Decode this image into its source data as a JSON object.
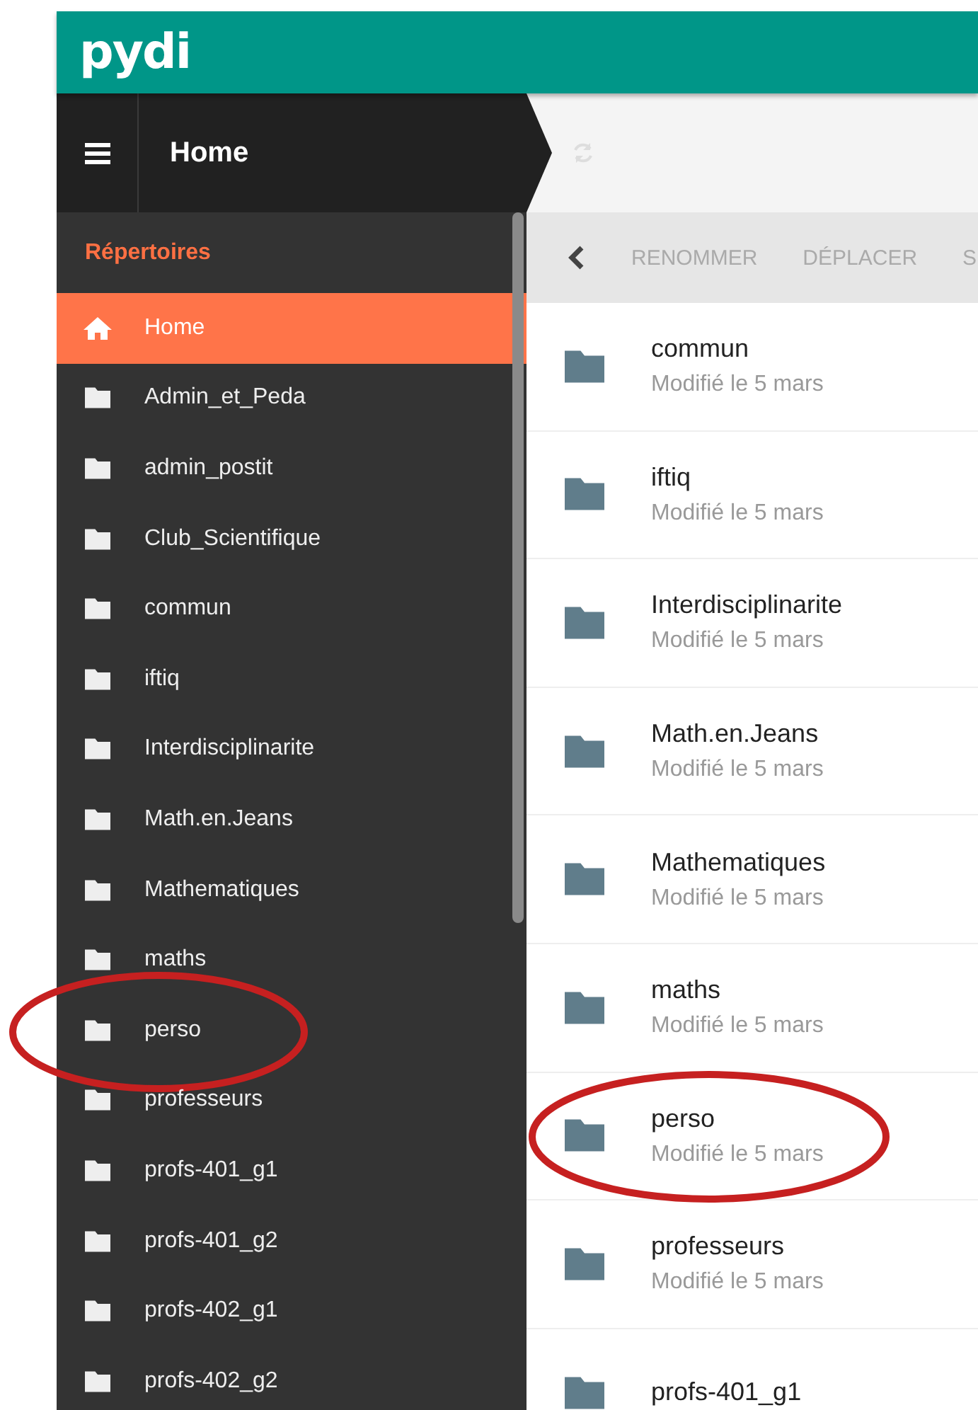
{
  "header": {
    "logo": "pydi",
    "title": "Home"
  },
  "sidebar": {
    "heading": "Répertoires",
    "items": [
      {
        "label": "Home",
        "kind": "home",
        "selected": true,
        "circled": false
      },
      {
        "label": "Admin_et_Peda",
        "kind": "folder",
        "selected": false,
        "circled": false
      },
      {
        "label": "admin_postit",
        "kind": "folder",
        "selected": false,
        "circled": false
      },
      {
        "label": "Club_Scientifique",
        "kind": "folder",
        "selected": false,
        "circled": false
      },
      {
        "label": "commun",
        "kind": "folder",
        "selected": false,
        "circled": false
      },
      {
        "label": "iftiq",
        "kind": "folder",
        "selected": false,
        "circled": false
      },
      {
        "label": "Interdisciplinarite",
        "kind": "folder",
        "selected": false,
        "circled": false
      },
      {
        "label": "Math.en.Jeans",
        "kind": "folder",
        "selected": false,
        "circled": false
      },
      {
        "label": "Mathematiques",
        "kind": "folder",
        "selected": false,
        "circled": false
      },
      {
        "label": "maths",
        "kind": "folder",
        "selected": false,
        "circled": false
      },
      {
        "label": "perso",
        "kind": "folder",
        "selected": false,
        "circled": true
      },
      {
        "label": "professeurs",
        "kind": "folder",
        "selected": false,
        "circled": false
      },
      {
        "label": "profs-401_g1",
        "kind": "folder",
        "selected": false,
        "circled": false
      },
      {
        "label": "profs-401_g2",
        "kind": "folder",
        "selected": false,
        "circled": false
      },
      {
        "label": "profs-402_g1",
        "kind": "folder",
        "selected": false,
        "circled": false
      },
      {
        "label": "profs-402_g2",
        "kind": "folder",
        "selected": false,
        "circled": false
      }
    ]
  },
  "toolbar": {
    "actions": [
      "RENOMMER",
      "DÉPLACER",
      "S"
    ]
  },
  "files": [
    {
      "name": "commun",
      "modified": "Modifié le 5 mars",
      "circled": false
    },
    {
      "name": "iftiq",
      "modified": "Modifié le 5 mars",
      "circled": false
    },
    {
      "name": "Interdisciplinarite",
      "modified": "Modifié le 5 mars",
      "circled": false
    },
    {
      "name": "Math.en.Jeans",
      "modified": "Modifié le 5 mars",
      "circled": false
    },
    {
      "name": "Mathematiques",
      "modified": "Modifié le 5 mars",
      "circled": false
    },
    {
      "name": "maths",
      "modified": "Modifié le 5 mars",
      "circled": false
    },
    {
      "name": "perso",
      "modified": "Modifié le 5 mars",
      "circled": true
    },
    {
      "name": "professeurs",
      "modified": "Modifié le 5 mars",
      "circled": false
    },
    {
      "name": "profs-401_g1",
      "circled": false
    }
  ]
}
